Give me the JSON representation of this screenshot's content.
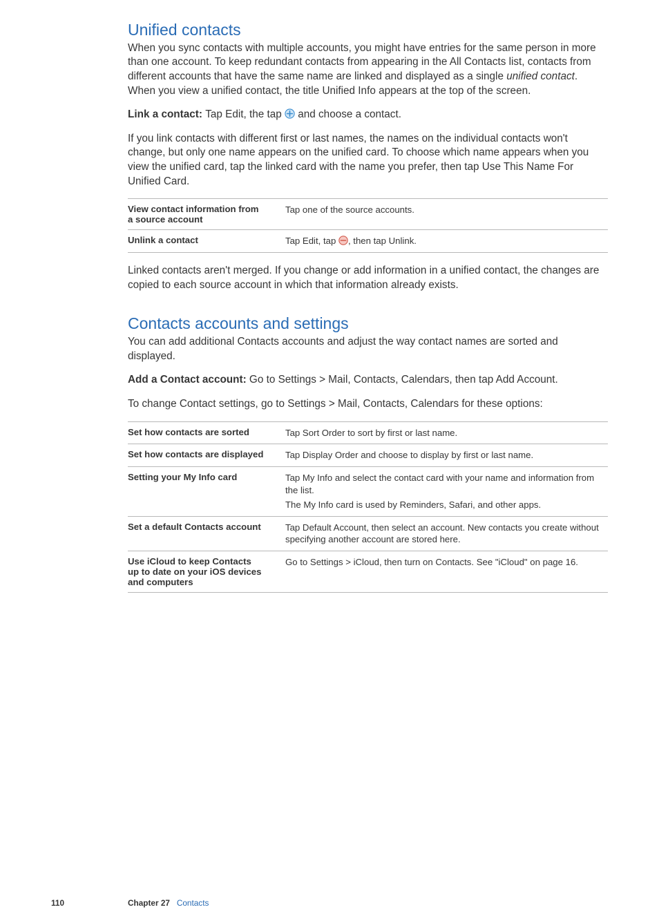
{
  "section1": {
    "heading": "Unified contacts",
    "para1": "When you sync contacts with multiple accounts, you might have entries for the same person in more than one account. To keep redundant contacts from appearing in the All Contacts list, contacts from different accounts that have the same name are linked and displayed as a single ",
    "para1_italic": "unified contact",
    "para1_tail": ". When you view a unified contact, the title Unified Info appears at the top of the screen.",
    "link_bold": "Link a contact:  ",
    "link_text1": "Tap Edit, the tap ",
    "link_text2": " and choose a contact.",
    "para2": "If you link contacts with different first or last names, the names on the individual contacts won't change, but only one name appears on the unified card. To choose which name appears when you view the unified card, tap the linked card with the name you prefer, then tap Use This Name For Unified Card.",
    "table": {
      "rows": [
        {
          "label1": "View contact information from",
          "label2": "a source account",
          "value": "Tap one of the source accounts."
        },
        {
          "label1": "Unlink a contact",
          "value_pre": "Tap Edit, tap ",
          "value_post": ", then tap Unlink."
        }
      ]
    },
    "para3": "Linked contacts aren't merged. If you change or add information in a unified contact, the changes are copied to each source account in which that information already exists."
  },
  "section2": {
    "heading": "Contacts accounts and settings",
    "para1": "You can add additional Contacts accounts and adjust the way contact names are sorted and displayed.",
    "add_bold": "Add a Contact account:  ",
    "add_text": "Go to Settings > Mail, Contacts, Calendars, then tap Add Account.",
    "para2": "To change Contact settings, go to Settings > Mail, Contacts, Calendars for these options:",
    "table": {
      "rows": [
        {
          "label": "Set how contacts are sorted",
          "value": "Tap Sort Order to sort by first or last name."
        },
        {
          "label": "Set how contacts are displayed",
          "value": "Tap Display Order and choose to display by first or last name."
        },
        {
          "label": "Setting your My Info card",
          "value1": "Tap My Info and select the contact card with your name and information from the list.",
          "value2": "The My Info card is used by Reminders, Safari, and other apps."
        },
        {
          "label": "Set a default Contacts account",
          "value": "Tap Default Account, then select an account. New contacts you create without specifying another account are stored here."
        },
        {
          "label1": "Use iCloud to keep Contacts",
          "label2": "up to date on your iOS devices",
          "label3": "and computers",
          "value": "Go to Settings > iCloud, then turn on Contacts. See \"iCloud\" on page 16."
        }
      ]
    }
  },
  "footer": {
    "page": "110",
    "chapter_bold": "Chapter 27",
    "chapter_link": "Contacts"
  }
}
